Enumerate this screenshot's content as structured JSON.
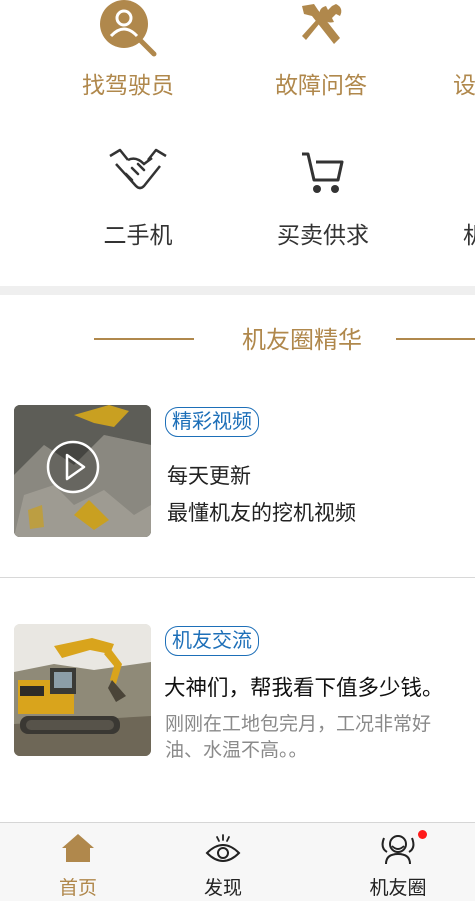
{
  "quick_menu": {
    "row1": [
      {
        "label": "找驾驶员",
        "icon": "search-driver-icon"
      },
      {
        "label": "故障问答",
        "icon": "repair-tools-icon"
      },
      {
        "label": "设",
        "icon": "settings-icon"
      }
    ],
    "row2": [
      {
        "label": "二手机",
        "icon": "handshake-icon"
      },
      {
        "label": "买卖供求",
        "icon": "shopping-cart-icon"
      },
      {
        "label": "机",
        "icon": "machine-icon"
      }
    ]
  },
  "section": {
    "title": "机友圈精华"
  },
  "posts": [
    {
      "tag": "精彩视频",
      "line1": "每天更新",
      "line2": "最懂机友的挖机视频"
    },
    {
      "tag": "机友交流",
      "line1": "大神们，帮我看下值多少钱。",
      "line2": "刚刚在工地包完月，工况非常好",
      "line3": "油、水温不高。。"
    }
  ],
  "tabbar": {
    "items": [
      {
        "label": "首页",
        "icon": "home-icon",
        "active": true
      },
      {
        "label": "发现",
        "icon": "eye-icon",
        "active": false
      },
      {
        "label": "机友圈",
        "icon": "friends-icon",
        "active": false,
        "badge": true
      }
    ]
  },
  "colors": {
    "accent": "#b0884c",
    "tag": "#1d6fb8",
    "badge": "#ff1a1a"
  }
}
